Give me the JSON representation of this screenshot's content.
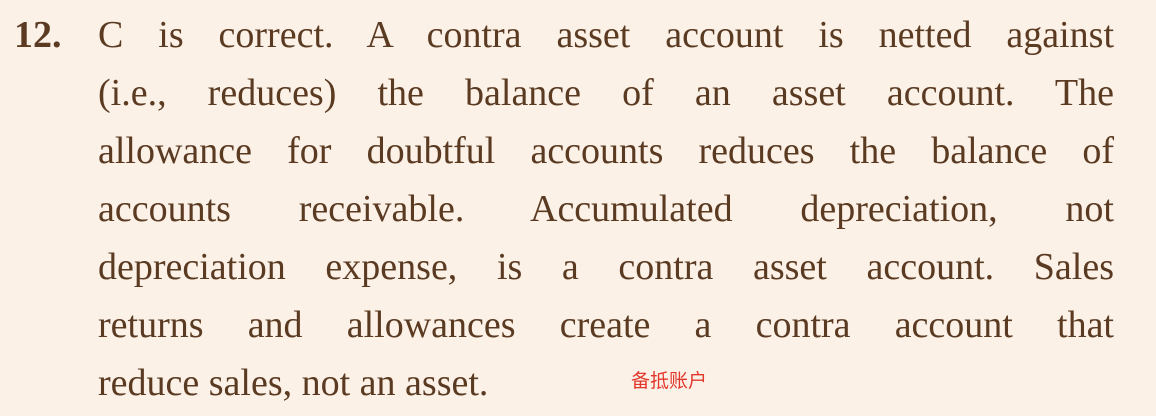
{
  "question": {
    "number": "12.",
    "lines": [
      "C is correct. A contra asset account is netted against",
      "(i.e., reduces) the balance of an asset account. The",
      "allowance for doubtful accounts reduces the balance of",
      "accounts receivable. Accumulated depreciation, not",
      "depreciation expense, is a contra asset account. Sales",
      "returns and allowances create a contra account that",
      "reduce sales, not an asset."
    ]
  },
  "annotation": {
    "text": "备抵账户",
    "color": "#e2382c"
  },
  "colors": {
    "background": "#fbf1e7",
    "text": "#5b3a22"
  }
}
